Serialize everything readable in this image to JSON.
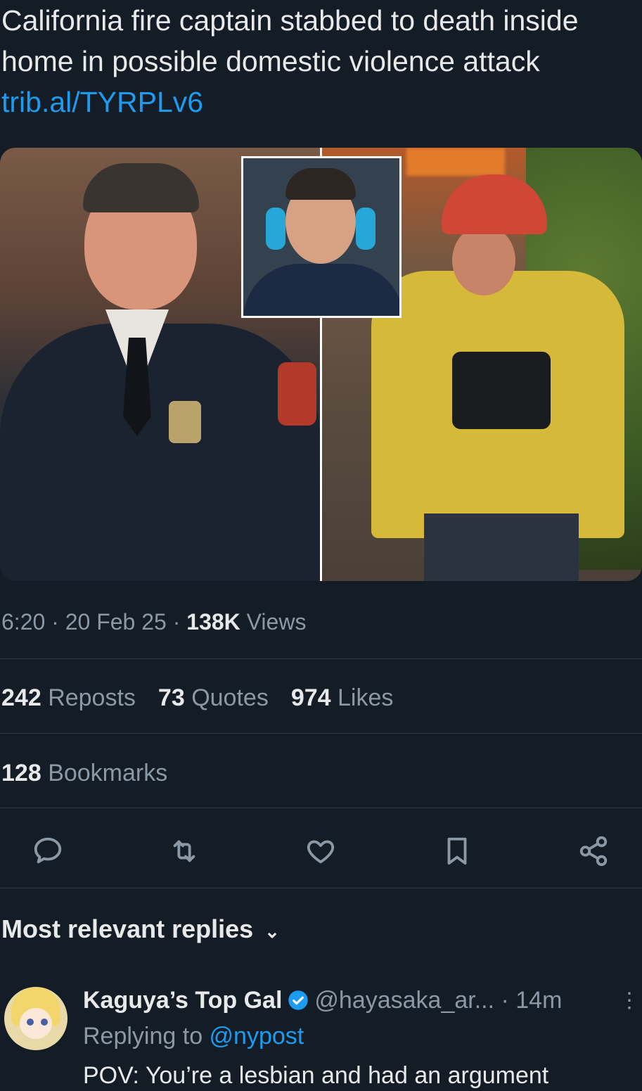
{
  "tweet": {
    "text": "California fire captain stabbed to death inside home in possible domestic violence attack",
    "link": "trib.al/TYRPLv6"
  },
  "media": {
    "left_alt": "photo-left",
    "inset_alt": "photo-inset",
    "right_alt": "photo-right"
  },
  "meta": {
    "time": "6:20",
    "sep1": " · ",
    "date": "20 Feb 25",
    "sep2": " · ",
    "views_count": "138K",
    "views_label": "Views"
  },
  "stats": {
    "reposts_count": "242",
    "reposts_label": "Reposts",
    "quotes_count": "73",
    "quotes_label": "Quotes",
    "likes_count": "974",
    "likes_label": "Likes",
    "bookmarks_count": "128",
    "bookmarks_label": "Bookmarks"
  },
  "actions": {
    "reply_icon": "reply-icon",
    "retweet_icon": "retweet-icon",
    "like_icon": "heart-icon",
    "bookmark_icon": "bookmark-icon",
    "share_icon": "share-icon",
    "icon_color": "#8b98a5"
  },
  "replies_section": {
    "title": "Most relevant replies",
    "chevron": "⌄"
  },
  "reply": {
    "name": "Kaguya’s Top Gal",
    "handle": "@hayasaka_ar...",
    "time": " · 14m",
    "replying_prefix": "Replying to ",
    "replying_to": "@nypost",
    "text": "POV: You’re a lesbi⁠an and had an argument",
    "more": "⋮",
    "verified_color": "#1d9bf0"
  },
  "colors": {
    "background": "#141d26",
    "text": "#e7e9ea",
    "muted": "#8b98a5",
    "link": "#1d9bf0"
  }
}
